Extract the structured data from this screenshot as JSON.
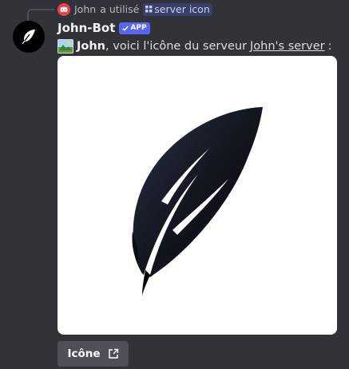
{
  "reply": {
    "user": "John",
    "action": "a utilisé",
    "command": "server icon",
    "avatar_color": "#ed4245"
  },
  "message": {
    "username": "John-Bot",
    "badge": "APP",
    "badge_color": "#5865f2",
    "mention": "John",
    "text": ", voici l'icône du serveur",
    "server_link": "John's server",
    "suffix": ":"
  },
  "embed": {
    "image": "feather-icon"
  },
  "button": {
    "label": "Icône",
    "icon": "external-link-icon"
  }
}
